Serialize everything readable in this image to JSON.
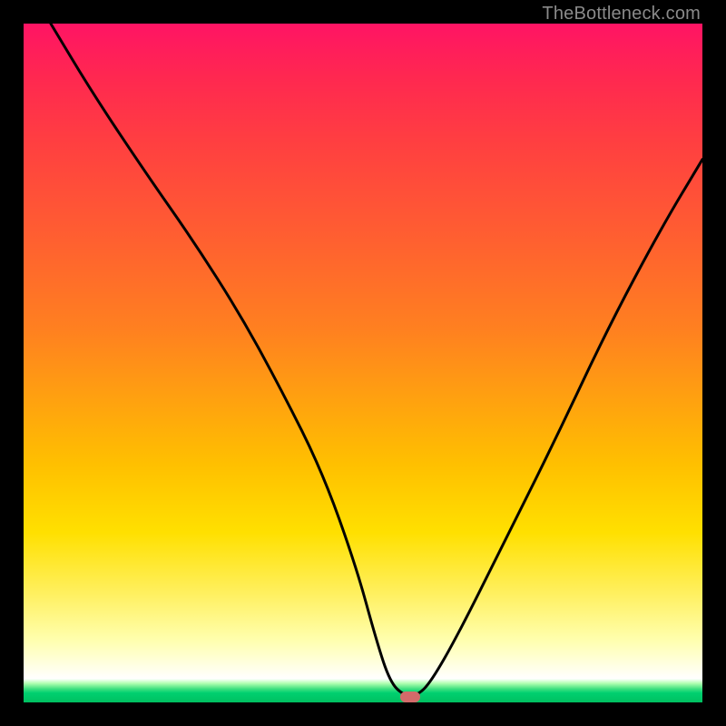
{
  "watermark": "TheBottleneck.com",
  "colors": {
    "frame": "#000000",
    "curve": "#000000",
    "marker": "#d46a6a"
  },
  "chart_data": {
    "type": "line",
    "title": "",
    "xlabel": "",
    "ylabel": "",
    "xlim": [
      0,
      100
    ],
    "ylim": [
      0,
      100
    ],
    "note": "Axes are unlabeled; values estimated from pixel positions on a 0–100 normalized grid. y represents distance from the green baseline (0 = bottom/green, 100 = top/red).",
    "series": [
      {
        "name": "bottleneck-curve",
        "x": [
          4,
          10,
          18,
          25,
          32,
          38,
          44,
          49,
          52,
          54,
          56,
          58,
          60,
          64,
          70,
          78,
          86,
          94,
          100
        ],
        "y": [
          100,
          90,
          78,
          68,
          57,
          46,
          34,
          20,
          9,
          3,
          1,
          1,
          3,
          10,
          22,
          38,
          55,
          70,
          80
        ]
      }
    ],
    "marker": {
      "x": 57,
      "y": 0.8,
      "shape": "rounded-rect"
    },
    "background_gradient": {
      "direction": "top-to-bottom",
      "stops": [
        {
          "pos": 0.0,
          "color": "#ff1464"
        },
        {
          "pos": 0.18,
          "color": "#ff4040"
        },
        {
          "pos": 0.45,
          "color": "#ff8020"
        },
        {
          "pos": 0.75,
          "color": "#ffe000"
        },
        {
          "pos": 0.965,
          "color": "#ffffff"
        },
        {
          "pos": 1.0,
          "color": "#00c060"
        }
      ]
    }
  }
}
